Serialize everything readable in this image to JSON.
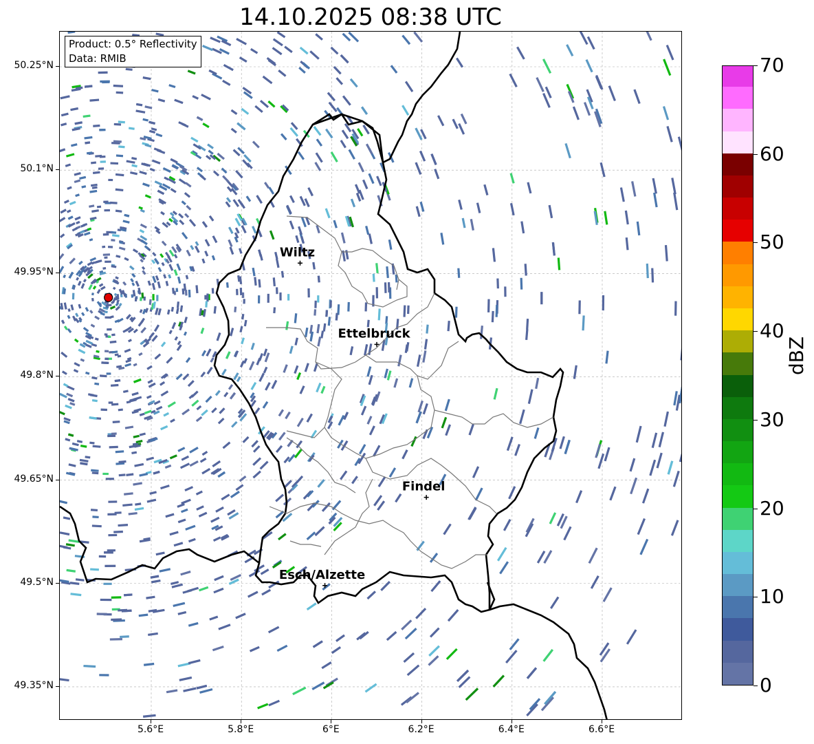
{
  "title": "14.10.2025 08:38 UTC",
  "info": {
    "product": "Product: 0.5° Reflectivity",
    "data": "Data: RMIB"
  },
  "axes": {
    "lon_range": [
      5.4,
      6.85
    ],
    "lat_range": [
      49.31,
      50.31
    ],
    "x_ticks": [
      {
        "value": 5.6,
        "label": "5.6°E"
      },
      {
        "value": 5.8,
        "label": "5.8°E"
      },
      {
        "value": 6.0,
        "label": "6°E"
      },
      {
        "value": 6.2,
        "label": "6.2°E"
      },
      {
        "value": 6.4,
        "label": "6.4°E"
      },
      {
        "value": 6.6,
        "label": "6.6°E"
      }
    ],
    "y_ticks": [
      {
        "value": 50.25,
        "label": "50.25°N"
      },
      {
        "value": 50.1,
        "label": "50.1°N"
      },
      {
        "value": 49.95,
        "label": "49.95°N"
      },
      {
        "value": 49.8,
        "label": "49.8°N"
      },
      {
        "value": 49.65,
        "label": "49.65°N"
      },
      {
        "value": 49.5,
        "label": "49.5°N"
      },
      {
        "value": 49.35,
        "label": "49.35°N"
      }
    ],
    "grid": true
  },
  "cities": [
    {
      "name": "Wiltz",
      "lon": 5.93,
      "lat": 49.965
    },
    {
      "name": "Ettelbruck",
      "lon": 6.1,
      "lat": 49.847
    },
    {
      "name": "Findel",
      "lon": 6.21,
      "lat": 49.625
    },
    {
      "name": "Esch/Alzette",
      "lon": 5.985,
      "lat": 49.497
    }
  ],
  "radar_site": {
    "lon": 5.505,
    "lat": 49.915,
    "color": "#e00000"
  },
  "colorbar": {
    "label": "dBZ",
    "min": 0,
    "max": 70,
    "step": 2.5,
    "tick_labels": [
      "0",
      "10",
      "20",
      "30",
      "40",
      "50",
      "60",
      "70"
    ],
    "colors": [
      "#6474a6",
      "#55679e",
      "#3f5a9c",
      "#4a76ad",
      "#5b9ac4",
      "#64bdd8",
      "#5dd6c8",
      "#3fd273",
      "#14c914",
      "#12b912",
      "#12a512",
      "#118f11",
      "#0e7a0e",
      "#0a5f0a",
      "#477a0a",
      "#adad05",
      "#ffd700",
      "#ffb300",
      "#ff9900",
      "#ff7f00",
      "#e60000",
      "#c80000",
      "#a00000",
      "#7a0000",
      "#ffe3ff",
      "#ffb5ff",
      "#ff6bff",
      "#e83be8"
    ]
  }
}
